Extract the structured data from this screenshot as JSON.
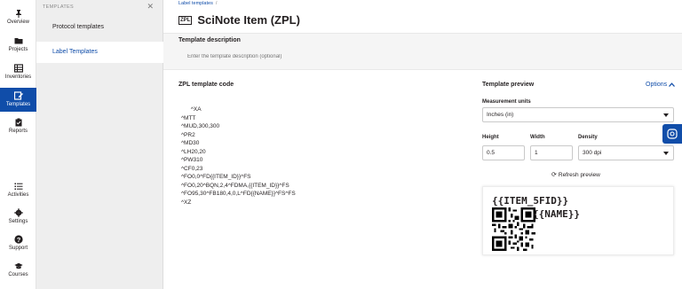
{
  "rail": {
    "items": [
      {
        "label": "Overview",
        "icon": "pin-icon"
      },
      {
        "label": "Projects",
        "icon": "folder-icon"
      },
      {
        "label": "Inventories",
        "icon": "inventory-icon"
      },
      {
        "label": "Templates",
        "icon": "template-icon"
      },
      {
        "label": "Reports",
        "icon": "clipboard-icon"
      },
      {
        "label": "Activities",
        "icon": "list-icon"
      },
      {
        "label": "Settings",
        "icon": "gear-icon"
      },
      {
        "label": "Support",
        "icon": "question-icon"
      },
      {
        "label": "Courses",
        "icon": "graduation-cap-icon"
      }
    ],
    "active": "Templates"
  },
  "submenu": {
    "header": "TEMPLATES",
    "close": "✕",
    "items": [
      "Protocol templates",
      "Label Templates"
    ],
    "active": "Label Templates"
  },
  "breadcrumb": {
    "item": "Label templates",
    "sep": "/"
  },
  "header": {
    "badge": "ZPL",
    "title": "SciNote Item (ZPL)"
  },
  "description": {
    "label": "Template description",
    "placeholder": "Enter the template description (optional)"
  },
  "zpl": {
    "label": "ZPL template code",
    "code": "      ^XA\n^MTT\n^MUD,300,300\n^PR2\n^MD30\n^LH20,20\n^PW310\n^CF0,23\n^FO0,0^FD{{ITEM_ID}}^FS\n^FO0,20^BQN,2,4^FDMA,{{ITEM_ID}}^FS\n^FO95,30^FB180,4,0,L^FD{{NAME}}^FS^FS\n^XZ"
  },
  "preview": {
    "label": "Template preview",
    "options": "Options",
    "units_label": "Measurement units",
    "units_value": "Inches (in)",
    "height_label": "Height",
    "height_value": "0.5",
    "width_label": "Width",
    "width_value": "1",
    "density_label": "Density",
    "density_value": "300 dpi",
    "refresh": "Refresh preview",
    "line1": "{{ITEM_5FID}}",
    "line2": "{{NAME}}"
  },
  "colors": {
    "accent": "#104da9"
  }
}
